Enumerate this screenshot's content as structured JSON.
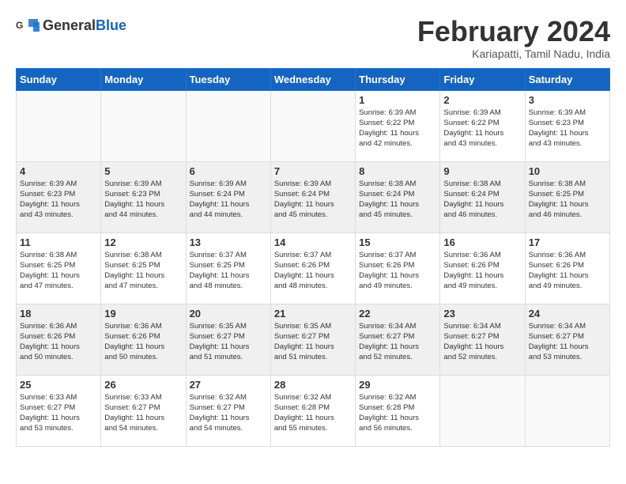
{
  "logo": {
    "general": "General",
    "blue": "Blue"
  },
  "title": "February 2024",
  "location": "Kariapatti, Tamil Nadu, India",
  "headers": [
    "Sunday",
    "Monday",
    "Tuesday",
    "Wednesday",
    "Thursday",
    "Friday",
    "Saturday"
  ],
  "weeks": [
    [
      {
        "day": "",
        "info": ""
      },
      {
        "day": "",
        "info": ""
      },
      {
        "day": "",
        "info": ""
      },
      {
        "day": "",
        "info": ""
      },
      {
        "day": "1",
        "info": "Sunrise: 6:39 AM\nSunset: 6:22 PM\nDaylight: 11 hours\nand 42 minutes."
      },
      {
        "day": "2",
        "info": "Sunrise: 6:39 AM\nSunset: 6:22 PM\nDaylight: 11 hours\nand 43 minutes."
      },
      {
        "day": "3",
        "info": "Sunrise: 6:39 AM\nSunset: 6:23 PM\nDaylight: 11 hours\nand 43 minutes."
      }
    ],
    [
      {
        "day": "4",
        "info": "Sunrise: 6:39 AM\nSunset: 6:23 PM\nDaylight: 11 hours\nand 43 minutes."
      },
      {
        "day": "5",
        "info": "Sunrise: 6:39 AM\nSunset: 6:23 PM\nDaylight: 11 hours\nand 44 minutes."
      },
      {
        "day": "6",
        "info": "Sunrise: 6:39 AM\nSunset: 6:24 PM\nDaylight: 11 hours\nand 44 minutes."
      },
      {
        "day": "7",
        "info": "Sunrise: 6:39 AM\nSunset: 6:24 PM\nDaylight: 11 hours\nand 45 minutes."
      },
      {
        "day": "8",
        "info": "Sunrise: 6:38 AM\nSunset: 6:24 PM\nDaylight: 11 hours\nand 45 minutes."
      },
      {
        "day": "9",
        "info": "Sunrise: 6:38 AM\nSunset: 6:24 PM\nDaylight: 11 hours\nand 46 minutes."
      },
      {
        "day": "10",
        "info": "Sunrise: 6:38 AM\nSunset: 6:25 PM\nDaylight: 11 hours\nand 46 minutes."
      }
    ],
    [
      {
        "day": "11",
        "info": "Sunrise: 6:38 AM\nSunset: 6:25 PM\nDaylight: 11 hours\nand 47 minutes."
      },
      {
        "day": "12",
        "info": "Sunrise: 6:38 AM\nSunset: 6:25 PM\nDaylight: 11 hours\nand 47 minutes."
      },
      {
        "day": "13",
        "info": "Sunrise: 6:37 AM\nSunset: 6:25 PM\nDaylight: 11 hours\nand 48 minutes."
      },
      {
        "day": "14",
        "info": "Sunrise: 6:37 AM\nSunset: 6:26 PM\nDaylight: 11 hours\nand 48 minutes."
      },
      {
        "day": "15",
        "info": "Sunrise: 6:37 AM\nSunset: 6:26 PM\nDaylight: 11 hours\nand 49 minutes."
      },
      {
        "day": "16",
        "info": "Sunrise: 6:36 AM\nSunset: 6:26 PM\nDaylight: 11 hours\nand 49 minutes."
      },
      {
        "day": "17",
        "info": "Sunrise: 6:36 AM\nSunset: 6:26 PM\nDaylight: 11 hours\nand 49 minutes."
      }
    ],
    [
      {
        "day": "18",
        "info": "Sunrise: 6:36 AM\nSunset: 6:26 PM\nDaylight: 11 hours\nand 50 minutes."
      },
      {
        "day": "19",
        "info": "Sunrise: 6:36 AM\nSunset: 6:26 PM\nDaylight: 11 hours\nand 50 minutes."
      },
      {
        "day": "20",
        "info": "Sunrise: 6:35 AM\nSunset: 6:27 PM\nDaylight: 11 hours\nand 51 minutes."
      },
      {
        "day": "21",
        "info": "Sunrise: 6:35 AM\nSunset: 6:27 PM\nDaylight: 11 hours\nand 51 minutes."
      },
      {
        "day": "22",
        "info": "Sunrise: 6:34 AM\nSunset: 6:27 PM\nDaylight: 11 hours\nand 52 minutes."
      },
      {
        "day": "23",
        "info": "Sunrise: 6:34 AM\nSunset: 6:27 PM\nDaylight: 11 hours\nand 52 minutes."
      },
      {
        "day": "24",
        "info": "Sunrise: 6:34 AM\nSunset: 6:27 PM\nDaylight: 11 hours\nand 53 minutes."
      }
    ],
    [
      {
        "day": "25",
        "info": "Sunrise: 6:33 AM\nSunset: 6:27 PM\nDaylight: 11 hours\nand 53 minutes."
      },
      {
        "day": "26",
        "info": "Sunrise: 6:33 AM\nSunset: 6:27 PM\nDaylight: 11 hours\nand 54 minutes."
      },
      {
        "day": "27",
        "info": "Sunrise: 6:32 AM\nSunset: 6:27 PM\nDaylight: 11 hours\nand 54 minutes."
      },
      {
        "day": "28",
        "info": "Sunrise: 6:32 AM\nSunset: 6:28 PM\nDaylight: 11 hours\nand 55 minutes."
      },
      {
        "day": "29",
        "info": "Sunrise: 6:32 AM\nSunset: 6:28 PM\nDaylight: 11 hours\nand 56 minutes."
      },
      {
        "day": "",
        "info": ""
      },
      {
        "day": "",
        "info": ""
      }
    ]
  ]
}
